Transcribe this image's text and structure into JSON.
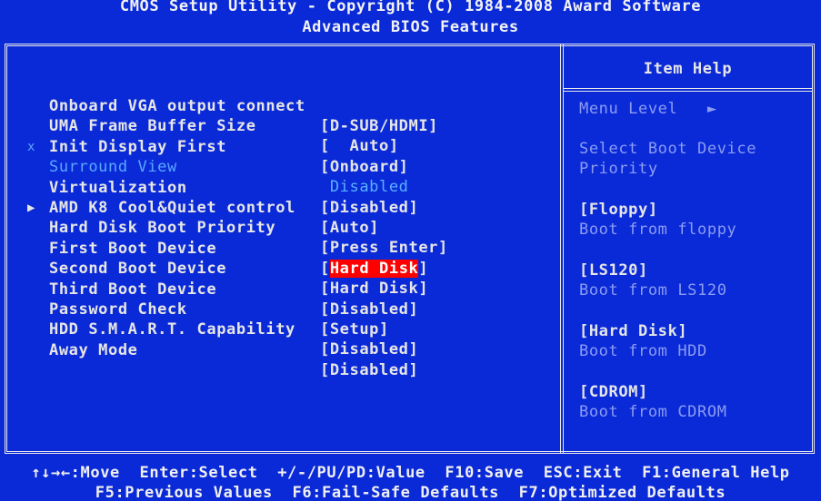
{
  "header": {
    "title": "CMOS Setup Utility - Copyright (C) 1984-2008 Award Software",
    "subtitle": "Advanced BIOS Features"
  },
  "settings": [
    {
      "marker": "",
      "label": "Onboard VGA output connect",
      "value": "[D-SUB/HDMI]",
      "state": "normal"
    },
    {
      "marker": "",
      "label": "UMA Frame Buffer Size",
      "value": "[  Auto]",
      "state": "normal"
    },
    {
      "marker": "",
      "label": "Init Display First",
      "value": "[Onboard]",
      "state": "normal"
    },
    {
      "marker": "x",
      "label": "Surround View",
      "value": " Disabled",
      "state": "disabled"
    },
    {
      "marker": "",
      "label": "Virtualization",
      "value": "[Disabled]",
      "state": "normal"
    },
    {
      "marker": "",
      "label": "AMD K8 Cool&Quiet control",
      "value": "[Auto]",
      "state": "normal"
    },
    {
      "marker": "▶",
      "label": "Hard Disk Boot Priority",
      "value": "[Press Enter]",
      "state": "normal"
    },
    {
      "marker": "",
      "label": "First Boot Device",
      "value_open": "[",
      "value_sel": "Hard Disk",
      "value_close": "]",
      "state": "selected"
    },
    {
      "marker": "",
      "label": "Second Boot Device",
      "value": "[Hard Disk]",
      "state": "normal"
    },
    {
      "marker": "",
      "label": "Third Boot Device",
      "value": "[Disabled]",
      "state": "normal"
    },
    {
      "marker": "",
      "label": "Password Check",
      "value": "[Setup]",
      "state": "normal"
    },
    {
      "marker": "",
      "label": "HDD S.M.A.R.T. Capability",
      "value": "[Disabled]",
      "state": "normal"
    },
    {
      "marker": "",
      "label": "Away Mode",
      "value": "[Disabled]",
      "state": "normal"
    }
  ],
  "help": {
    "title": "Item Help",
    "menu_level": "Menu Level   ►",
    "lines": [
      {
        "text": "Select Boot Device",
        "kind": "desc"
      },
      {
        "text": "Priority",
        "kind": "desc"
      },
      {
        "text": "[Floppy]",
        "kind": "key"
      },
      {
        "text": "Boot from floppy",
        "kind": "desc"
      },
      {
        "text": "[LS120]",
        "kind": "key"
      },
      {
        "text": "Boot from LS120",
        "kind": "desc"
      },
      {
        "text": "[Hard Disk]",
        "kind": "key"
      },
      {
        "text": "Boot from HDD",
        "kind": "desc"
      },
      {
        "text": "[CDROM]",
        "kind": "key"
      },
      {
        "text": "Boot from CDROM",
        "kind": "desc"
      }
    ]
  },
  "footer": {
    "line1": "↑↓→←:Move  Enter:Select  +/-/PU/PD:Value  F10:Save  ESC:Exit  F1:General Help",
    "line2": "F5:Previous Values  F6:Fail-Safe Defaults  F7:Optimized Defaults"
  },
  "colors": {
    "background": "#0a2ad8",
    "text": "#e6e6e6",
    "disabled": "#5aa8ff",
    "selection": "#ff0000",
    "help_desc": "#8c9cf2"
  }
}
